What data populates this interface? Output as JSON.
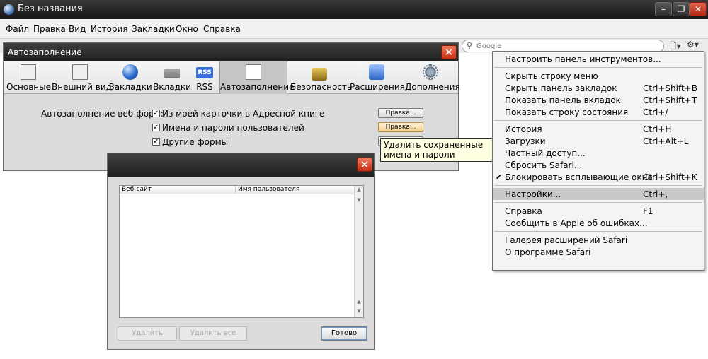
{
  "window": {
    "title": "Без названия"
  },
  "window_controls": {
    "minimize": "–",
    "maximize": "❐",
    "close": "✕"
  },
  "menubar": [
    "Файл",
    "Правка",
    "Вид",
    "История",
    "Закладки",
    "Окно",
    "Справка"
  ],
  "toolbar": {
    "search_placeholder": "Google",
    "page_icon": "🗋▾",
    "gear_icon": "⚙▾"
  },
  "prefs": {
    "title": "Автозаполнение",
    "close": "✕",
    "tabs": [
      {
        "label": "Основные",
        "icon": "general-switch-icon"
      },
      {
        "label": "Внешний вид",
        "icon": "appearance-icon"
      },
      {
        "label": "Закладки",
        "icon": "bookmarks-globe-icon"
      },
      {
        "label": "Вкладки",
        "icon": "tabs-icon"
      },
      {
        "label": "RSS",
        "icon": "rss-icon",
        "text": "RSS"
      },
      {
        "label": "Автозаполнение",
        "icon": "autofill-pen-icon",
        "active": true
      },
      {
        "label": "Безопасность",
        "icon": "security-lock-icon"
      },
      {
        "label": "Расширения",
        "icon": "extensions-icon"
      },
      {
        "label": "Дополнения",
        "icon": "advanced-gear-icon"
      }
    ],
    "autofill_label": "Автозаполнение веб-форм:",
    "options": [
      {
        "label": "Из моей карточки в Адресной книге",
        "checked": true,
        "button": "Правка..."
      },
      {
        "label": "Имена и пароли пользователей",
        "checked": true,
        "button": "Правка..."
      },
      {
        "label": "Другие формы",
        "checked": true,
        "button": ""
      }
    ],
    "check_mark": "✓"
  },
  "tooltip": {
    "text": "Удалить сохраненные имена и пароли"
  },
  "dialog": {
    "close": "✕",
    "columns": [
      "Веб-сайт",
      "Имя пользователя"
    ],
    "buttons": {
      "remove": "Удалить",
      "remove_all": "Удалить все",
      "done": "Готово"
    },
    "scroll_up": "▲",
    "scroll_down": "▼"
  },
  "dropdown": {
    "check": "✔",
    "items": [
      {
        "label": "Настроить панель инструментов...",
        "shortcut": ""
      },
      {
        "sep": true
      },
      {
        "label": "Скрыть строку меню",
        "shortcut": ""
      },
      {
        "label": "Скрыть панель закладок",
        "shortcut": "Ctrl+Shift+B"
      },
      {
        "label": "Показать панель вкладок",
        "shortcut": "Ctrl+Shift+T"
      },
      {
        "label": "Показать строку состояния",
        "shortcut": "Ctrl+/"
      },
      {
        "sep": true
      },
      {
        "label": "История",
        "shortcut": "Ctrl+H"
      },
      {
        "label": "Загрузки",
        "shortcut": "Ctrl+Alt+L"
      },
      {
        "label": "Частный доступ...",
        "shortcut": ""
      },
      {
        "label": "Сбросить Safari...",
        "shortcut": ""
      },
      {
        "label": "Блокировать всплывающие окна",
        "shortcut": "Ctrl+Shift+K",
        "checked": true
      },
      {
        "sep": true
      },
      {
        "label": "Настройки...",
        "shortcut": "Ctrl+,",
        "highlighted": true
      },
      {
        "sep": true
      },
      {
        "label": "Справка",
        "shortcut": "F1"
      },
      {
        "label": "Сообщить в Apple об ошибках...",
        "shortcut": ""
      },
      {
        "sep": true
      },
      {
        "label": "Галерея расширений Safari",
        "shortcut": ""
      },
      {
        "label": "О программе Safari",
        "shortcut": ""
      }
    ]
  }
}
